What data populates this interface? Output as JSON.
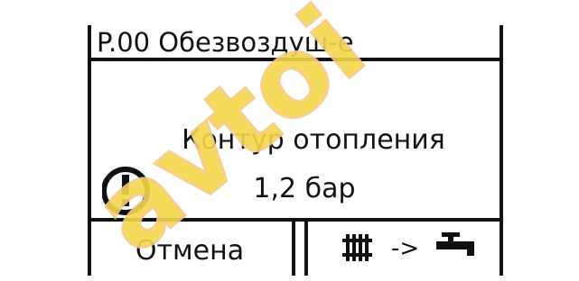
{
  "screen": {
    "title": "P.00 Обезвоздуш-е",
    "message_line1": "Контур отопления",
    "message_line2": "1,2 бар"
  },
  "softkeys": {
    "left_label": "Отмена",
    "right_icons": [
      "radiator-icon",
      "arrow-icon",
      "faucet-icon"
    ],
    "right_arrow_text": "->"
  },
  "watermark": {
    "text": "avtoi"
  },
  "colors": {
    "display_fg": "#111111",
    "display_bg": "#ffffff",
    "watermark_fill": "#f5d84a",
    "watermark_stroke": "#f7c97e"
  }
}
